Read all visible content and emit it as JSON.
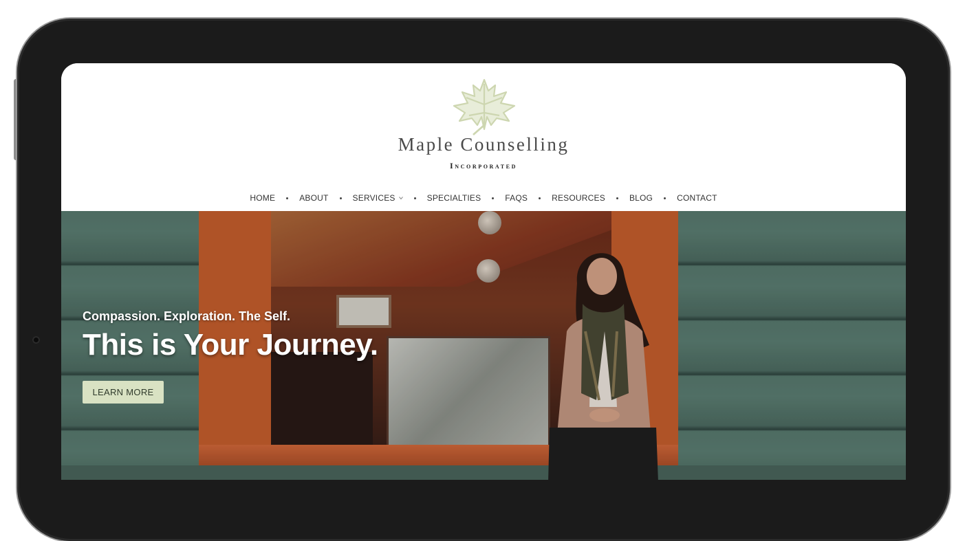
{
  "brand": {
    "name": "Maple Counselling",
    "subtitle": "Incorporated"
  },
  "nav": {
    "items": [
      {
        "label": "HOME"
      },
      {
        "label": "ABOUT"
      },
      {
        "label": "SERVICES",
        "has_dropdown": true
      },
      {
        "label": "SPECIALTIES"
      },
      {
        "label": "FAQS"
      },
      {
        "label": "RESOURCES"
      },
      {
        "label": "BLOG"
      },
      {
        "label": "CONTACT"
      }
    ]
  },
  "hero": {
    "tagline": "Compassion. Exploration. The Self.",
    "headline": "This is Your Journey.",
    "cta_label": "LEARN MORE"
  },
  "colors": {
    "accent_button": "#d9e2c3",
    "leaf": "#cdd6b0",
    "frame_orange": "#c85f2d",
    "siding_green": "#587a6f"
  },
  "icons": {
    "logo": "maple-leaf-icon",
    "dropdown": "chevron-down-icon"
  }
}
